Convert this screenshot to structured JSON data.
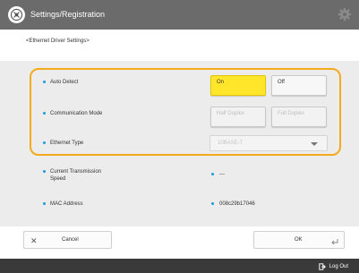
{
  "header": {
    "title": "Settings/Registration"
  },
  "breadcrumb": "<Ethernet Driver Settings>",
  "settings": {
    "auto_detect": {
      "label": "Auto Detect",
      "on": "On",
      "off": "Off",
      "selected": "On"
    },
    "communication_mode": {
      "label": "Communication Mode",
      "half": "Half Duplex",
      "full": "Full Duplex"
    },
    "ethernet_type": {
      "label": "Ethernet Type",
      "value": "10BASE-T"
    },
    "transmission_speed": {
      "label_line1": "Current Transmission",
      "label_line2": "Speed",
      "value": "---"
    },
    "mac_address": {
      "label": "MAC Address",
      "value": "008c29b17046"
    }
  },
  "actions": {
    "cancel": "Cancel",
    "ok": "OK"
  },
  "footer": {
    "logout": "Log Out"
  },
  "colors": {
    "accent": "#f3aa1c",
    "selected": "#ffe62a",
    "titlebar": "#6b6b6b",
    "bullet": "#1a9ad6"
  }
}
